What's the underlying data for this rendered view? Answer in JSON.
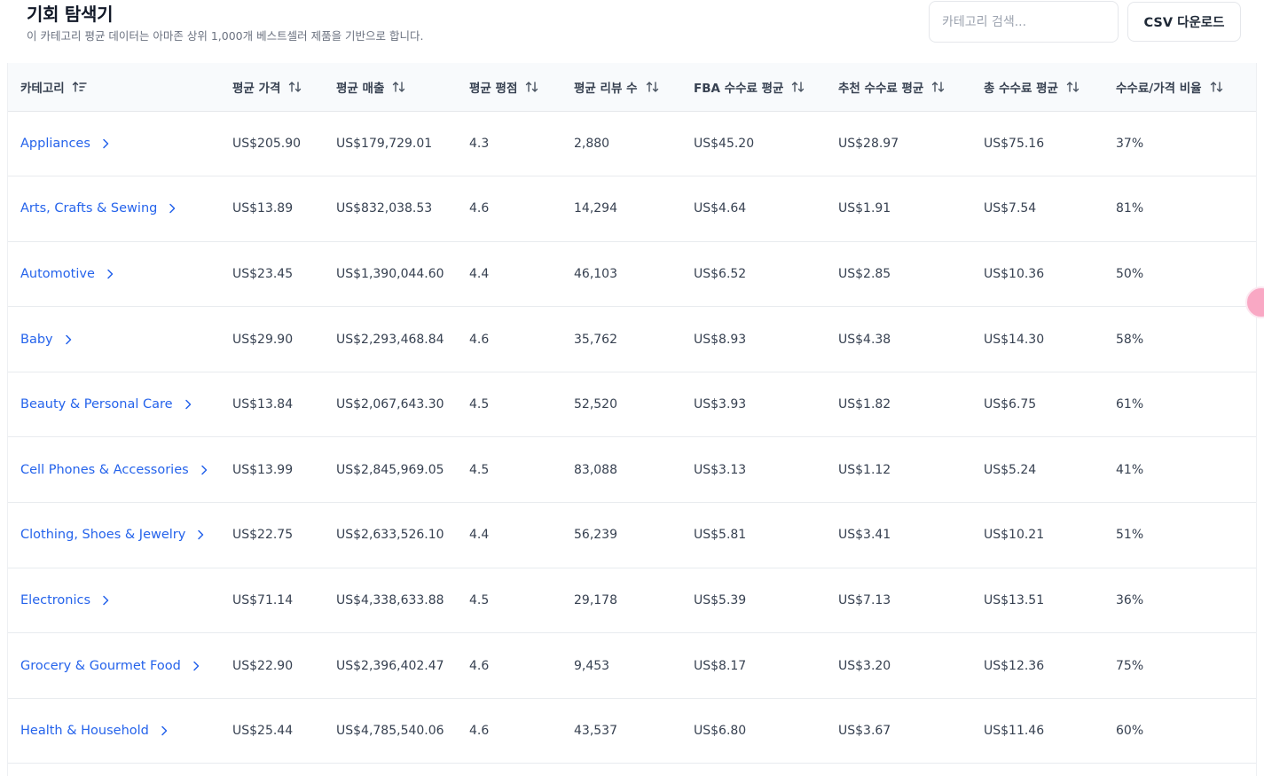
{
  "header": {
    "title": "기회 탐색기",
    "subtitle": "이 카테고리 평균 데이터는 아마존 상위 1,000개 베스트셀러 제품을 기반으로 합니다.",
    "search_placeholder": "카테고리 검색...",
    "csv_label": "CSV 다운로드"
  },
  "columns": [
    "카테고리",
    "평균 가격",
    "평균 매출",
    "평균 평점",
    "평균 리뷰 수",
    "FBA 수수료 평균",
    "추천 수수료 평균",
    "총 수수료 평균",
    "수수료/가격 비율"
  ],
  "rows": [
    {
      "category": "Appliances",
      "price": "US$205.90",
      "sales": "US$179,729.01",
      "rating": "4.3",
      "reviews": "2,880",
      "fba": "US$45.20",
      "referral": "US$28.97",
      "total": "US$75.16",
      "ratio": "37%"
    },
    {
      "category": "Arts, Crafts & Sewing",
      "price": "US$13.89",
      "sales": "US$832,038.53",
      "rating": "4.6",
      "reviews": "14,294",
      "fba": "US$4.64",
      "referral": "US$1.91",
      "total": "US$7.54",
      "ratio": "81%"
    },
    {
      "category": "Automotive",
      "price": "US$23.45",
      "sales": "US$1,390,044.60",
      "rating": "4.4",
      "reviews": "46,103",
      "fba": "US$6.52",
      "referral": "US$2.85",
      "total": "US$10.36",
      "ratio": "50%"
    },
    {
      "category": "Baby",
      "price": "US$29.90",
      "sales": "US$2,293,468.84",
      "rating": "4.6",
      "reviews": "35,762",
      "fba": "US$8.93",
      "referral": "US$4.38",
      "total": "US$14.30",
      "ratio": "58%"
    },
    {
      "category": "Beauty & Personal Care",
      "price": "US$13.84",
      "sales": "US$2,067,643.30",
      "rating": "4.5",
      "reviews": "52,520",
      "fba": "US$3.93",
      "referral": "US$1.82",
      "total": "US$6.75",
      "ratio": "61%"
    },
    {
      "category": "Cell Phones & Accessories",
      "price": "US$13.99",
      "sales": "US$2,845,969.05",
      "rating": "4.5",
      "reviews": "83,088",
      "fba": "US$3.13",
      "referral": "US$1.12",
      "total": "US$5.24",
      "ratio": "41%"
    },
    {
      "category": "Clothing, Shoes & Jewelry",
      "price": "US$22.75",
      "sales": "US$2,633,526.10",
      "rating": "4.4",
      "reviews": "56,239",
      "fba": "US$5.81",
      "referral": "US$3.41",
      "total": "US$10.21",
      "ratio": "51%"
    },
    {
      "category": "Electronics",
      "price": "US$71.14",
      "sales": "US$4,338,633.88",
      "rating": "4.5",
      "reviews": "29,178",
      "fba": "US$5.39",
      "referral": "US$7.13",
      "total": "US$13.51",
      "ratio": "36%"
    },
    {
      "category": "Grocery & Gourmet Food",
      "price": "US$22.90",
      "sales": "US$2,396,402.47",
      "rating": "4.6",
      "reviews": "9,453",
      "fba": "US$8.17",
      "referral": "US$3.20",
      "total": "US$12.36",
      "ratio": "75%"
    },
    {
      "category": "Health & Household",
      "price": "US$25.44",
      "sales": "US$4,785,540.06",
      "rating": "4.6",
      "reviews": "43,537",
      "fba": "US$6.80",
      "referral": "US$3.67",
      "total": "US$11.46",
      "ratio": "60%"
    }
  ],
  "icons": {
    "sort_active": "sort-ascending-icon",
    "sort": "sort-icon",
    "row_chevron": "chevron-right-icon",
    "floating": "assistant-star-icon"
  },
  "colors": {
    "link": "#2563eb",
    "header_bg": "#f8fafc",
    "badge": "#f9a8c4"
  }
}
